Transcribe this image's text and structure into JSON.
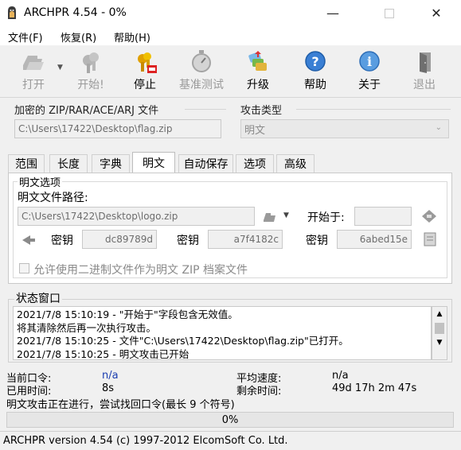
{
  "window": {
    "title": "ARCHPR 4.54 - 0%"
  },
  "menu": {
    "items": [
      "文件(F)",
      "恢复(R)",
      "帮助(H)"
    ]
  },
  "toolbar": {
    "buttons": [
      {
        "label": "打开",
        "icon": "open-icon",
        "enabled": false
      },
      {
        "label": "开始!",
        "icon": "start-icon",
        "enabled": false
      },
      {
        "label": "停止",
        "icon": "stop-icon",
        "enabled": true
      },
      {
        "label": "基准测试",
        "icon": "benchmark-icon",
        "enabled": false
      },
      {
        "label": "升级",
        "icon": "upgrade-icon",
        "enabled": true
      },
      {
        "label": "帮助",
        "icon": "help-icon",
        "enabled": true
      },
      {
        "label": "关于",
        "icon": "about-icon",
        "enabled": true
      },
      {
        "label": "退出",
        "icon": "exit-icon",
        "enabled": false
      }
    ]
  },
  "encrypted_file": {
    "label": "加密的 ZIP/RAR/ACE/ARJ 文件",
    "path": "C:\\Users\\17422\\Desktop\\flag.zip"
  },
  "attack_type": {
    "label": "攻击类型",
    "value": "明文"
  },
  "tabs": [
    "范围",
    "长度",
    "字典",
    "明文",
    "自动保存",
    "选项",
    "高级"
  ],
  "active_tab": "明文",
  "plaintext": {
    "group_label": "明文选项",
    "path_label": "明文文件路径:",
    "path": "C:\\Users\\17422\\Desktop\\logo.zip",
    "start_label": "开始于:",
    "start_value": "",
    "key_label": "密钥",
    "keys": [
      "dc89789d",
      "a7f4182c",
      "6abed15e"
    ],
    "allow_binary_label": "允许使用二进制文件作为明文 ZIP 档案文件"
  },
  "status_window": {
    "label": "状态窗口",
    "log": [
      "2021/7/8 15:10:19 - \"开始于\"字段包含无效值。",
      "将其清除然后再一次执行攻击。",
      "2021/7/8 15:10:25 - 文件\"C:\\Users\\17422\\Desktop\\flag.zip\"已打开。",
      "2021/7/8 15:10:25 - 明文攻击已开始"
    ]
  },
  "stats": {
    "current_password_label": "当前口令:",
    "current_password": "n/a",
    "elapsed_label": "已用时间:",
    "elapsed": "8s",
    "avg_speed_label": "平均速度:",
    "avg_speed": "n/a",
    "remaining_label": "剩余时间:",
    "remaining": "49d 17h 2m 47s"
  },
  "progress": {
    "message": "明文攻击正在进行，尝试找回口令(最长 9 个符号)",
    "percent_text": "0%",
    "percent": 0
  },
  "statusbar": {
    "text": "ARCHPR version 4.54 (c) 1997-2012 ElcomSoft Co. Ltd."
  }
}
